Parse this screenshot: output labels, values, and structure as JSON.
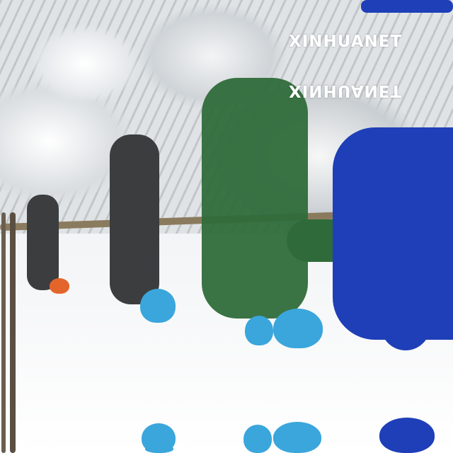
{
  "image": {
    "watermark_text": "XINHUANET",
    "watermark_mirrored_text": "XINHUANET",
    "colors": {
      "snow": "#f4f6f8",
      "jacket_blue": "#1f3fb8",
      "jacket_green": "#2f6b3a",
      "jacket_grey": "#3b3d3f",
      "helmet_blue": "#3aa6dc",
      "helmet_orange": "#e4652b"
    }
  }
}
